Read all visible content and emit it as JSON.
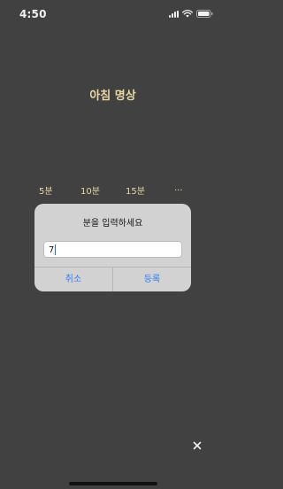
{
  "status_bar": {
    "time": "4:50"
  },
  "screen": {
    "title": "아침 명상",
    "time_options": [
      "5분",
      "10분",
      "15분",
      "..."
    ]
  },
  "dialog": {
    "title": "분을 입력하세요",
    "input_value": "7",
    "cancel_label": "취소",
    "confirm_label": "등록"
  },
  "colors": {
    "background": "#414141",
    "accent_text": "#e8d7a4",
    "dialog_bg": "#d2d2d2",
    "dialog_button": "#2d7df6"
  },
  "icons": {
    "signal": "cellular-signal-icon",
    "wifi": "wifi-icon",
    "battery": "battery-icon",
    "close": "close-icon"
  }
}
